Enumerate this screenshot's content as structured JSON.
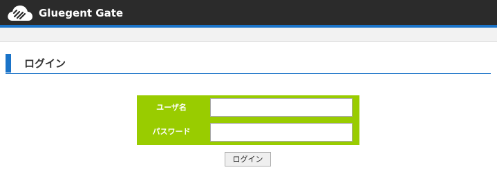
{
  "header": {
    "app_title": "Gluegent Gate",
    "logo_icon": "cloud-logo-icon",
    "background_color": "#2b2b2b",
    "accent_color": "#1a73c8"
  },
  "section": {
    "title": "ログイン"
  },
  "login_form": {
    "background_color": "#99cc00",
    "username_label": "ユーザ名",
    "username_value": "",
    "password_label": "パスワード",
    "password_value": "",
    "submit_label": "ログイン"
  }
}
